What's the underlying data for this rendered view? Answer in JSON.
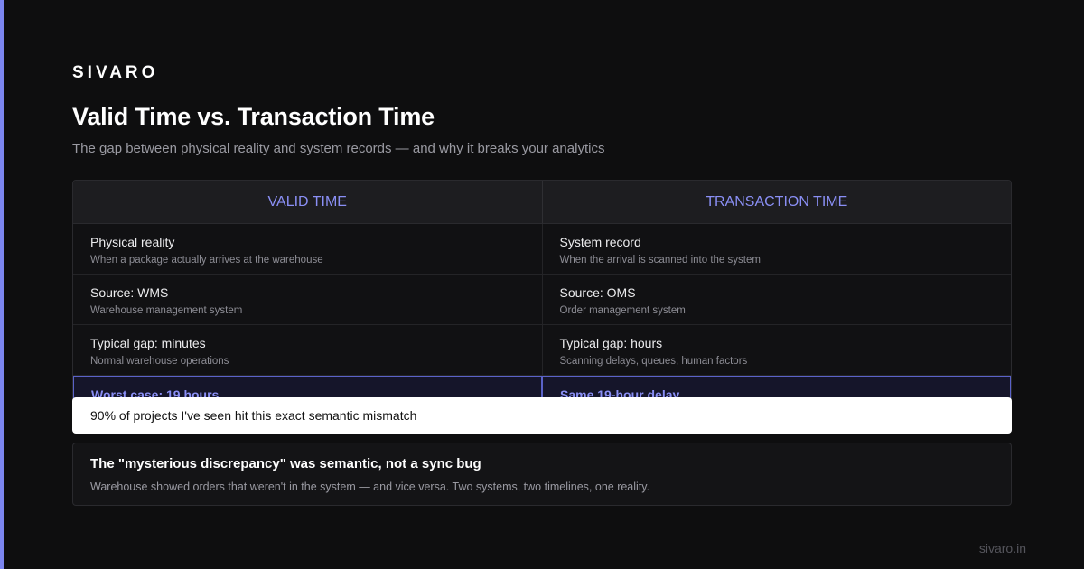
{
  "brand": "SIVARO",
  "title": "Valid Time vs. Transaction Time",
  "subtitle": "The gap between physical reality and system records — and why it breaks your analytics",
  "table": {
    "headers": [
      "VALID TIME",
      "TRANSACTION TIME"
    ],
    "rows": [
      {
        "left": {
          "main": "Physical reality",
          "sub": "When a package actually arrives at the warehouse"
        },
        "right": {
          "main": "System record",
          "sub": "When the arrival is scanned into the system"
        }
      },
      {
        "left": {
          "main": "Source: WMS",
          "sub": "Warehouse management system"
        },
        "right": {
          "main": "Source: OMS",
          "sub": "Order management system"
        }
      },
      {
        "left": {
          "main": "Typical gap: minutes",
          "sub": "Normal warehouse operations"
        },
        "right": {
          "main": "Typical gap: hours",
          "sub": "Scanning delays, queues, human factors"
        }
      },
      {
        "left": {
          "main": "Worst case: 19 hours",
          "sub": ""
        },
        "right": {
          "main": "Same 19-hour delay",
          "sub": ""
        }
      }
    ]
  },
  "tooltip": "90% of projects I've seen hit this exact semantic mismatch",
  "callout": {
    "title": "The \"mysterious discrepancy\" was semantic, not a sync bug",
    "text": "Warehouse showed orders that weren't in the system — and vice versa. Two systems, two timelines, one reality."
  },
  "footer": "sivaro.in",
  "colors": {
    "background": "#0e0e0f",
    "accent": "#7c86f0",
    "header_text": "#8a8ff5"
  }
}
